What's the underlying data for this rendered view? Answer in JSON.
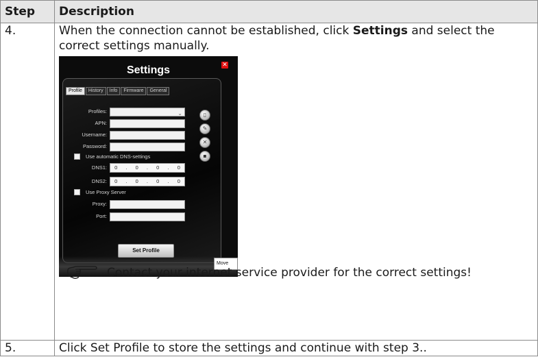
{
  "header": {
    "step": "Step",
    "description": "Description"
  },
  "rows": [
    {
      "step": "4.",
      "text_before": "When the connection cannot be established, click ",
      "text_bold": "Settings",
      "text_after": " and select the correct settings manually.",
      "dialog": {
        "title": "Settings",
        "tabs": [
          "Profile",
          "History",
          "Info",
          "Firmware",
          "General"
        ],
        "fields": {
          "profiles": "Profiles:",
          "apn": "APN:",
          "username": "Username:",
          "password": "Password:",
          "dns_checkbox": "Use automatic DNS-settings",
          "dns1": "DNS1:",
          "dns2": "DNS2:",
          "proxy_checkbox": "Use Proxy Server",
          "proxy": "Proxy:",
          "port": "Port:"
        },
        "ip_octets": [
          "0",
          "0",
          "0",
          "0"
        ],
        "ip_dot": ".",
        "set_profile": "Set Profile",
        "move_tooltip": "Move"
      },
      "note": "Contact your internet service provider for the correct settings!"
    },
    {
      "step": "5.",
      "text": "Click Set Profile to store the settings and continue with step 3.."
    }
  ],
  "icons": {
    "note": "pointing-hand-icon",
    "close": "close-icon"
  }
}
